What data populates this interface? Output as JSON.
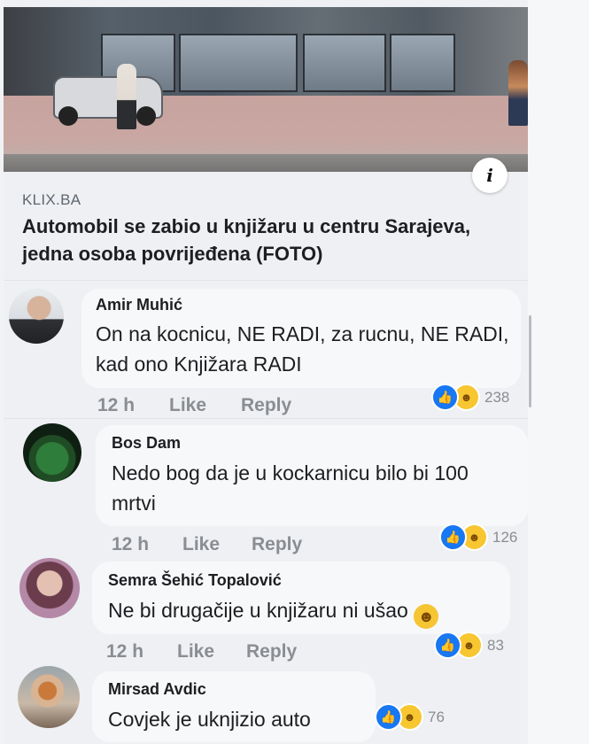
{
  "post": {
    "source": "KLIX.BA",
    "headline": "Automobil se zabio u knjižaru u centru Sarajeva, jedna osoba povrijeđena (FOTO)",
    "info_icon": "i"
  },
  "comments": [
    {
      "author": "Amir Muhić",
      "text": "On na kocnicu, NE RADI, za rucnu, NE RADI, kad ono Knjižara RADI",
      "time": "12 h",
      "like_label": "Like",
      "reply_label": "Reply",
      "reactions": [
        "like",
        "haha"
      ],
      "reaction_count": "238"
    },
    {
      "author": "Bos Dam",
      "text": "Nedo bog da je u kockarnicu bilo bi 100 mrtvi",
      "time": "12 h",
      "like_label": "Like",
      "reply_label": "Reply",
      "reactions": [
        "like",
        "haha"
      ],
      "reaction_count": "126"
    },
    {
      "author": "Semra Šehić Topalović",
      "text": "Ne bi drugačije u knjižaru ni ušao",
      "time": "12 h",
      "like_label": "Like",
      "reply_label": "Reply",
      "reactions": [
        "like",
        "haha"
      ],
      "reaction_count": "83"
    },
    {
      "author": "Mirsad Avdic",
      "text": "Covjek je uknjizio auto",
      "reactions": [
        "like",
        "haha"
      ],
      "reaction_count": "76"
    }
  ],
  "colors": {
    "like_blue": "#1877f2",
    "haha_yellow": "#f7c631",
    "meta_gray": "#8a8d91"
  }
}
